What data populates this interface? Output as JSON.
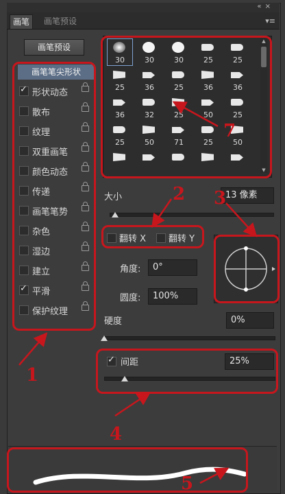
{
  "window": {
    "collapse_glyph": "«  ×",
    "menu_glyph": "▾≡"
  },
  "tabs": [
    {
      "label": "画笔",
      "active": true
    },
    {
      "label": "画笔预设",
      "active": false
    }
  ],
  "preset_button": "画笔预设",
  "options": {
    "header": "画笔笔尖形状",
    "items": [
      {
        "label": "形状动态",
        "checked": true
      },
      {
        "label": "散布",
        "checked": false
      },
      {
        "label": "纹理",
        "checked": false
      },
      {
        "label": "双重画笔",
        "checked": false
      },
      {
        "label": "颜色动态",
        "checked": false
      },
      {
        "label": "传递",
        "checked": false
      },
      {
        "label": "画笔笔势",
        "checked": false
      },
      {
        "label": "杂色",
        "checked": false
      },
      {
        "label": "湿边",
        "checked": false
      },
      {
        "label": "建立",
        "checked": false
      },
      {
        "label": "平滑",
        "checked": true
      },
      {
        "label": "保护纹理",
        "checked": false
      }
    ]
  },
  "brush_grid": {
    "sizes": [
      [
        "30",
        "30",
        "30",
        "25",
        "25"
      ],
      [
        "25",
        "36",
        "25",
        "36",
        "36"
      ],
      [
        "36",
        "32",
        "25",
        "50",
        "25"
      ],
      [
        "25",
        "50",
        "71",
        "25",
        "50"
      ],
      [
        "",
        "",
        "",
        "",
        ""
      ]
    ],
    "selected_index": 0
  },
  "size": {
    "label": "大小",
    "value": "13 像素"
  },
  "flip": {
    "x_label": "翻转 X",
    "y_label": "翻转 Y"
  },
  "angle": {
    "label": "角度:",
    "value": "0°"
  },
  "roundness": {
    "label": "圆度:",
    "value": "100%"
  },
  "hardness": {
    "label": "硬度",
    "value": "0%"
  },
  "spacing": {
    "label": "间距",
    "value": "25%",
    "checked": true
  },
  "annotations": {
    "colors": {
      "red": "#c8161d",
      "selection": "#5c6e86"
    },
    "numbers": [
      "1",
      "2",
      "3",
      "4",
      "5",
      "7"
    ]
  }
}
